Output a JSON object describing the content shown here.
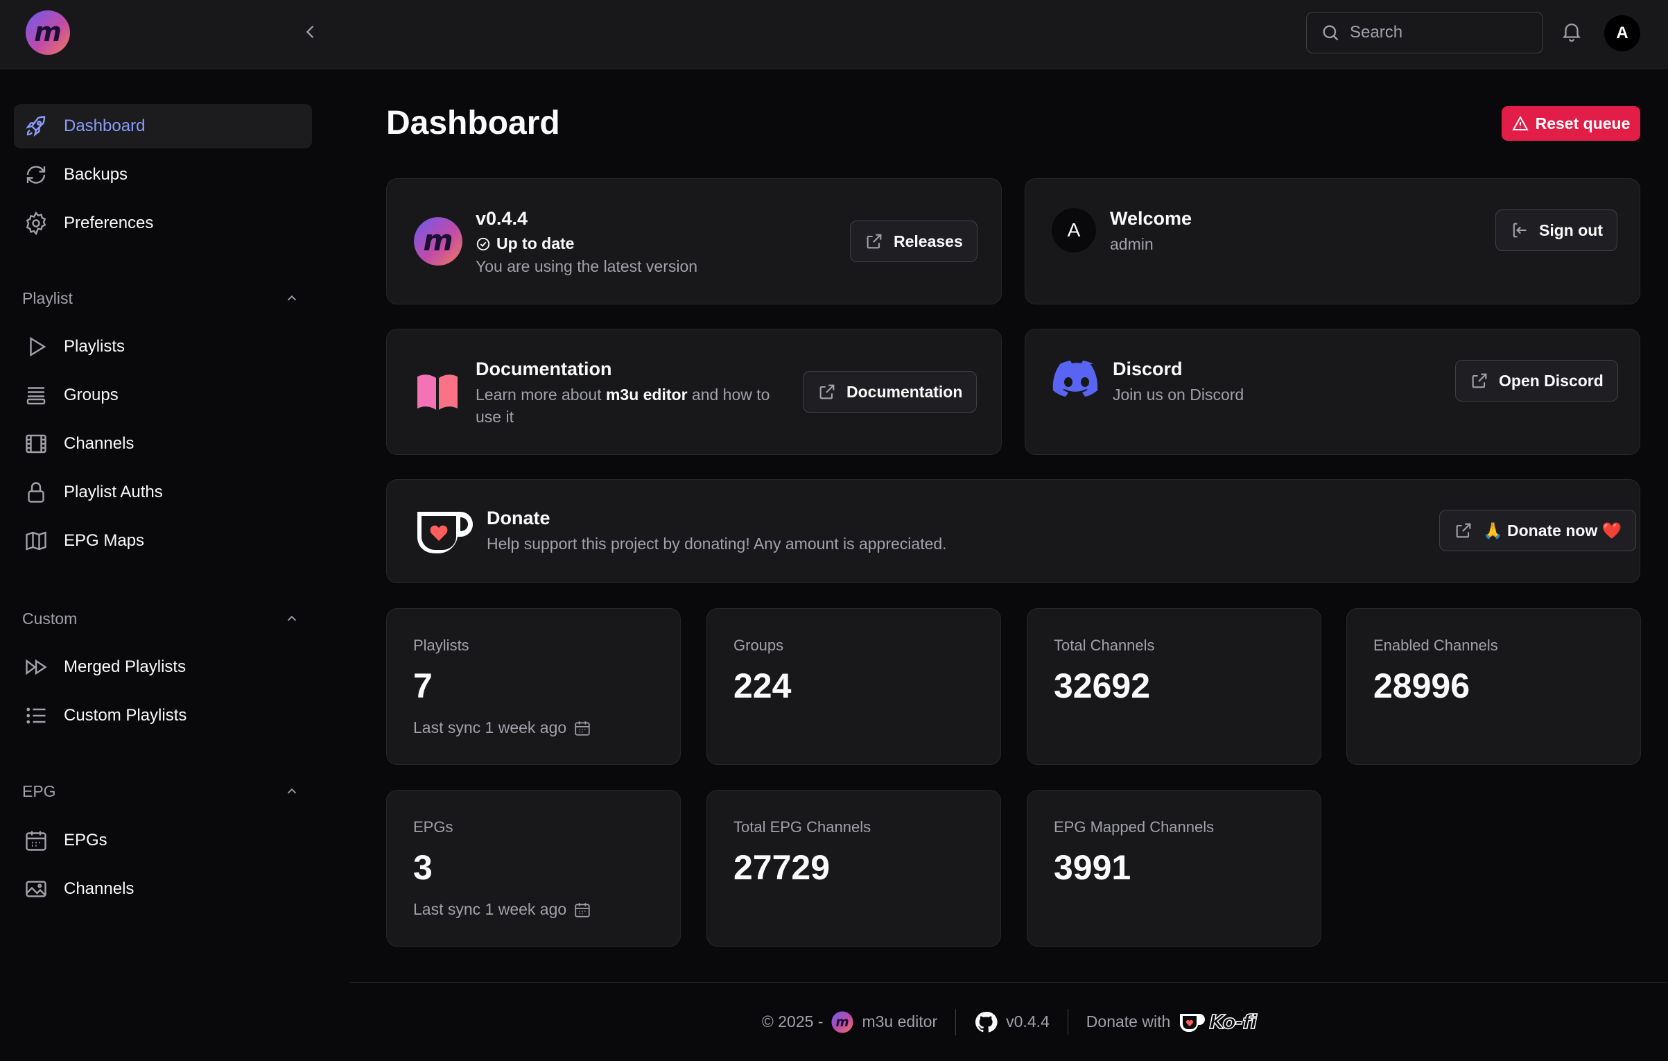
{
  "topbar": {
    "search_placeholder": "Search",
    "avatar_initial": "A"
  },
  "sidebar": {
    "top_items": [
      {
        "label": "Dashboard",
        "icon": "rocket-icon",
        "active": true
      },
      {
        "label": "Backups",
        "icon": "refresh-icon"
      },
      {
        "label": "Preferences",
        "icon": "gear-icon"
      }
    ],
    "groups": [
      {
        "label": "Playlist",
        "items": [
          {
            "label": "Playlists",
            "icon": "play-icon"
          },
          {
            "label": "Groups",
            "icon": "queue-list-icon"
          },
          {
            "label": "Channels",
            "icon": "film-icon"
          },
          {
            "label": "Playlist Auths",
            "icon": "lock-icon"
          },
          {
            "label": "EPG Maps",
            "icon": "map-icon"
          }
        ]
      },
      {
        "label": "Custom",
        "items": [
          {
            "label": "Merged Playlists",
            "icon": "forward-icon"
          },
          {
            "label": "Custom Playlists",
            "icon": "list-bullet-icon"
          }
        ]
      },
      {
        "label": "EPG",
        "items": [
          {
            "label": "EPGs",
            "icon": "calendar-icon"
          },
          {
            "label": "Channels",
            "icon": "photo-icon"
          }
        ]
      }
    ]
  },
  "main": {
    "title": "Dashboard",
    "reset_label": "Reset queue",
    "version_card": {
      "version": "v0.4.4",
      "status": "Up to date",
      "description": "You are using the latest version",
      "button": "Releases"
    },
    "welcome_card": {
      "avatar_initial": "A",
      "title": "Welcome",
      "username": "admin",
      "button": "Sign out"
    },
    "docs_card": {
      "title": "Documentation",
      "desc_prefix": "Learn more about ",
      "desc_bold": "m3u editor",
      "desc_suffix": " and how to use it",
      "button": "Documentation"
    },
    "discord_card": {
      "title": "Discord",
      "description": "Join us on Discord",
      "button": "Open Discord"
    },
    "donate_card": {
      "title": "Donate",
      "description": "Help support this project by donating! Any amount is appreciated.",
      "button": "🙏 Donate now ❤️"
    },
    "stats": [
      {
        "label": "Playlists",
        "value": "7",
        "sync": "Last sync 1 week ago"
      },
      {
        "label": "Groups",
        "value": "224"
      },
      {
        "label": "Total Channels",
        "value": "32692"
      },
      {
        "label": "Enabled Channels",
        "value": "28996"
      },
      {
        "label": "EPGs",
        "value": "3",
        "sync": "Last sync 1 week ago"
      },
      {
        "label": "Total EPG Channels",
        "value": "27729"
      },
      {
        "label": "EPG Mapped Channels",
        "value": "3991"
      }
    ]
  },
  "footer": {
    "copyright": "© 2025 -",
    "app_name": "m3u editor",
    "version": "v0.4.4",
    "donate_with": "Donate with",
    "kofi_text": "Ko-fi"
  },
  "colors": {
    "accent": "#8b9cf8",
    "danger": "#e11d48",
    "discord": "#5865f2",
    "background": "#09090b",
    "card": "#18181b"
  }
}
